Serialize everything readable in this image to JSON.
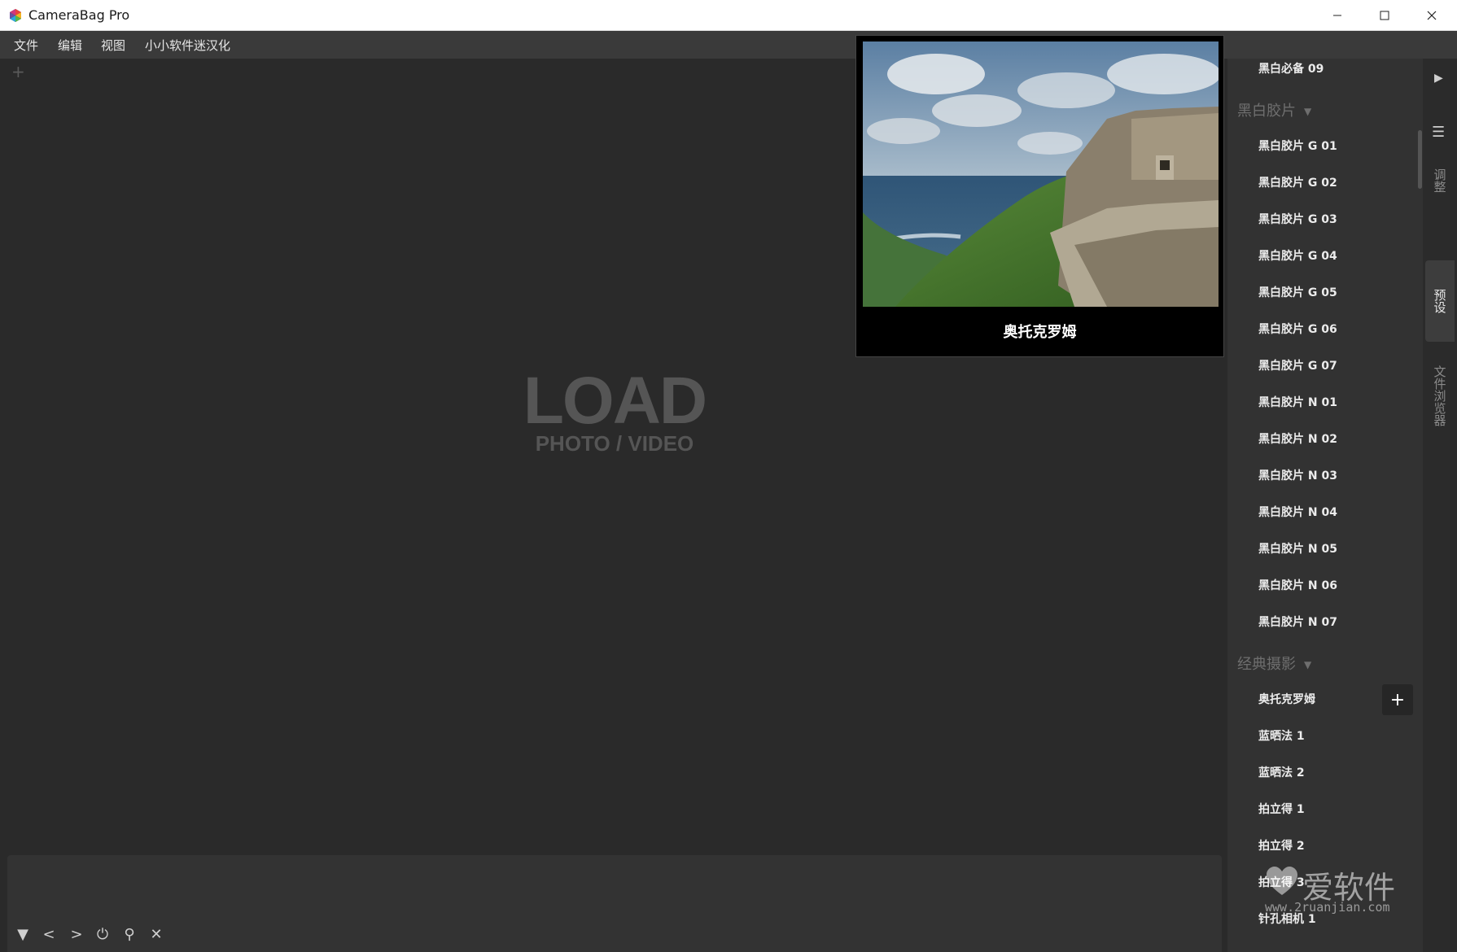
{
  "window": {
    "title": "CameraBag Pro"
  },
  "menu": [
    "文件",
    "编辑",
    "视图",
    "小小软件迷汉化"
  ],
  "canvas": {
    "load_title": "LOAD",
    "load_subtitle": "PHOTO / VIDEO",
    "add_tab_icon": "plus-icon"
  },
  "preview": {
    "caption": "奥托克罗姆"
  },
  "presets": {
    "top_item": "黑白必备 09",
    "groups": [
      {
        "name": "黑白胶片",
        "items": [
          "黑白胶片 G 01",
          "黑白胶片 G 02",
          "黑白胶片 G 03",
          "黑白胶片 G 04",
          "黑白胶片 G 05",
          "黑白胶片 G 06",
          "黑白胶片 G 07",
          "黑白胶片 N 01",
          "黑白胶片 N 02",
          "黑白胶片 N 03",
          "黑白胶片 N 04",
          "黑白胶片 N 05",
          "黑白胶片 N 06",
          "黑白胶片 N 07"
        ]
      },
      {
        "name": "经典摄影",
        "items": [
          "奥托克罗姆",
          "蓝晒法 1",
          "蓝晒法 2",
          "拍立得 1",
          "拍立得 2",
          "拍立得 3",
          "针孔相机 1"
        ]
      }
    ],
    "add_button": "+"
  },
  "side_tabs": {
    "adjust": "调整",
    "presets": "预设",
    "browser": "文件浏览器"
  },
  "toolbar_icons": [
    "triangle-down-icon",
    "prev-icon",
    "next-icon",
    "power-icon",
    "zoom-icon",
    "close-icon"
  ],
  "watermark": {
    "text": "爱软件",
    "url": "www.2ruanjian.com"
  },
  "colors": {
    "background": "#2a2a2a",
    "panel": "#323232",
    "menubar": "#3a3a3a",
    "titlebar": "#ffffff"
  }
}
